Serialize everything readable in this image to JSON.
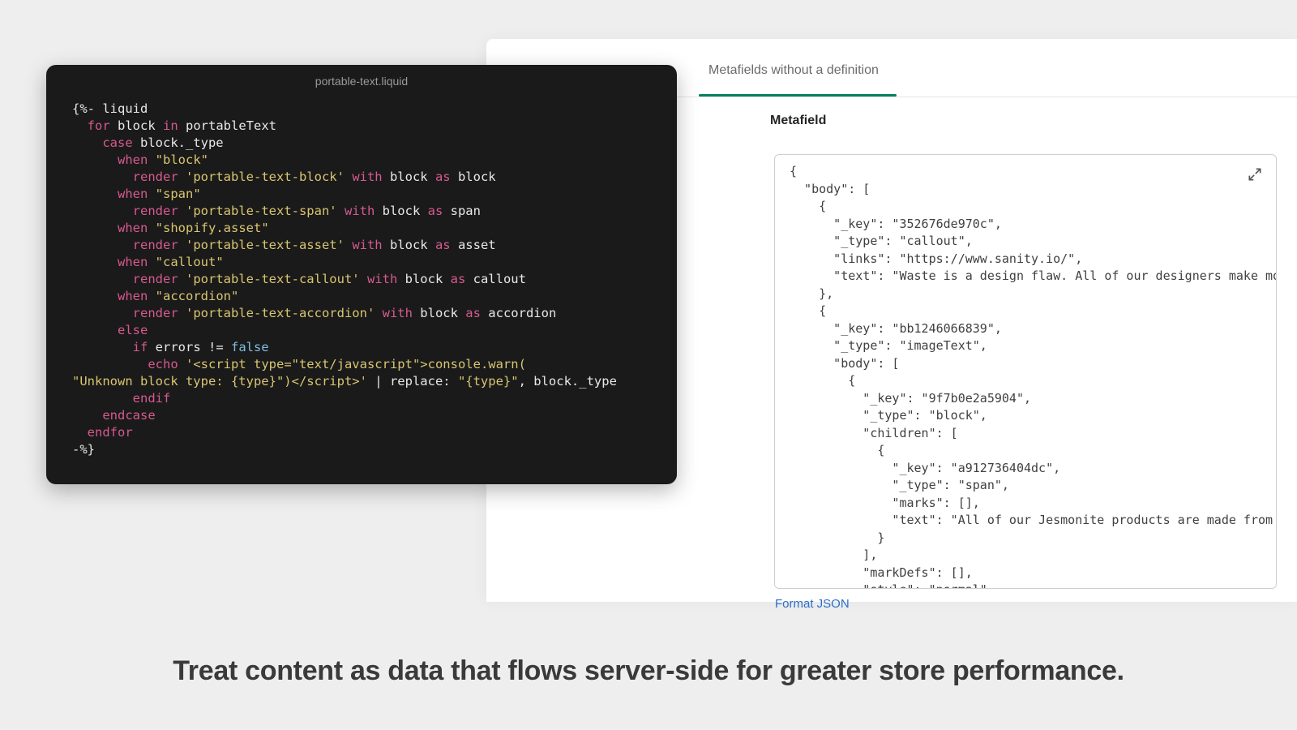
{
  "code_editor": {
    "filename": "portable-text.liquid",
    "tokens": [
      [
        [
          "plain",
          "{%- liquid"
        ]
      ],
      [
        [
          "plain",
          "  "
        ],
        [
          "kw",
          "for"
        ],
        [
          "plain",
          " block "
        ],
        [
          "kw",
          "in"
        ],
        [
          "plain",
          " portableText"
        ]
      ],
      [
        [
          "plain",
          "    "
        ],
        [
          "kw",
          "case"
        ],
        [
          "plain",
          " block._type"
        ]
      ],
      [
        [
          "plain",
          "      "
        ],
        [
          "kw",
          "when"
        ],
        [
          "plain",
          " "
        ],
        [
          "str",
          "\"block\""
        ]
      ],
      [
        [
          "plain",
          "        "
        ],
        [
          "kw",
          "render"
        ],
        [
          "plain",
          " "
        ],
        [
          "str",
          "'portable-text-block'"
        ],
        [
          "plain",
          " "
        ],
        [
          "kw",
          "with"
        ],
        [
          "plain",
          " block "
        ],
        [
          "kw",
          "as"
        ],
        [
          "plain",
          " block"
        ]
      ],
      [
        [
          "plain",
          "      "
        ],
        [
          "kw",
          "when"
        ],
        [
          "plain",
          " "
        ],
        [
          "str",
          "\"span\""
        ]
      ],
      [
        [
          "plain",
          "        "
        ],
        [
          "kw",
          "render"
        ],
        [
          "plain",
          " "
        ],
        [
          "str",
          "'portable-text-span'"
        ],
        [
          "plain",
          " "
        ],
        [
          "kw",
          "with"
        ],
        [
          "plain",
          " block "
        ],
        [
          "kw",
          "as"
        ],
        [
          "plain",
          " span"
        ]
      ],
      [
        [
          "plain",
          "      "
        ],
        [
          "kw",
          "when"
        ],
        [
          "plain",
          " "
        ],
        [
          "str",
          "\"shopify.asset\""
        ]
      ],
      [
        [
          "plain",
          "        "
        ],
        [
          "kw",
          "render"
        ],
        [
          "plain",
          " "
        ],
        [
          "str",
          "'portable-text-asset'"
        ],
        [
          "plain",
          " "
        ],
        [
          "kw",
          "with"
        ],
        [
          "plain",
          " block "
        ],
        [
          "kw",
          "as"
        ],
        [
          "plain",
          " asset"
        ]
      ],
      [
        [
          "plain",
          "      "
        ],
        [
          "kw",
          "when"
        ],
        [
          "plain",
          " "
        ],
        [
          "str",
          "\"callout\""
        ]
      ],
      [
        [
          "plain",
          "        "
        ],
        [
          "kw",
          "render"
        ],
        [
          "plain",
          " "
        ],
        [
          "str",
          "'portable-text-callout'"
        ],
        [
          "plain",
          " "
        ],
        [
          "kw",
          "with"
        ],
        [
          "plain",
          " block "
        ],
        [
          "kw",
          "as"
        ],
        [
          "plain",
          " callout"
        ]
      ],
      [
        [
          "plain",
          "      "
        ],
        [
          "kw",
          "when"
        ],
        [
          "plain",
          " "
        ],
        [
          "str",
          "\"accordion\""
        ]
      ],
      [
        [
          "plain",
          "        "
        ],
        [
          "kw",
          "render"
        ],
        [
          "plain",
          " "
        ],
        [
          "str",
          "'portable-text-accordion'"
        ],
        [
          "plain",
          " "
        ],
        [
          "kw",
          "with"
        ],
        [
          "plain",
          " block "
        ],
        [
          "kw",
          "as"
        ],
        [
          "plain",
          " accordion"
        ]
      ],
      [
        [
          "plain",
          "      "
        ],
        [
          "kw",
          "else"
        ]
      ],
      [
        [
          "plain",
          "        "
        ],
        [
          "kw",
          "if"
        ],
        [
          "plain",
          " errors != "
        ],
        [
          "bool",
          "false"
        ]
      ],
      [
        [
          "plain",
          "          "
        ],
        [
          "kw",
          "echo"
        ],
        [
          "plain",
          " "
        ],
        [
          "str",
          "'<script type=\"text/javascript\">console.warn("
        ]
      ],
      [
        [
          "str",
          "\"Unknown block type: {type}\")</script>'"
        ],
        [
          "plain",
          " | replace: "
        ],
        [
          "str",
          "\"{type}\""
        ],
        [
          "plain",
          ", block._type"
        ]
      ],
      [
        [
          "plain",
          "        "
        ],
        [
          "kw",
          "endif"
        ]
      ],
      [
        [
          "plain",
          "    "
        ],
        [
          "kw",
          "endcase"
        ]
      ],
      [
        [
          "plain",
          "  "
        ],
        [
          "kw",
          "endfor"
        ]
      ],
      [
        [
          "plain",
          "-%}"
        ]
      ]
    ]
  },
  "admin": {
    "tab_label": "Metafields without a definition",
    "section_heading": "Metafield",
    "format_link": "Format JSON",
    "json_text": "{\n  \"body\": [\n    {\n      \"_key\": \"352676de970c\",\n      \"_type\": \"callout\",\n      \"links\": \"https://www.sanity.io/\",\n      \"text\": \"Waste is a design flaw. All of our designers make mo\n    },\n    {\n      \"_key\": \"bb1246066839\",\n      \"_type\": \"imageText\",\n      \"body\": [\n        {\n          \"_key\": \"9f7b0e2a5904\",\n          \"_type\": \"block\",\n          \"children\": [\n            {\n              \"_key\": \"a912736404dc\",\n              \"_type\": \"span\",\n              \"marks\": [],\n              \"text\": \"All of our Jesmonite products are made from\n            }\n          ],\n          \"markDefs\": [],\n          \"style\": \"normal\""
  },
  "caption": "Treat content as data that flows server-side for greater store performance."
}
